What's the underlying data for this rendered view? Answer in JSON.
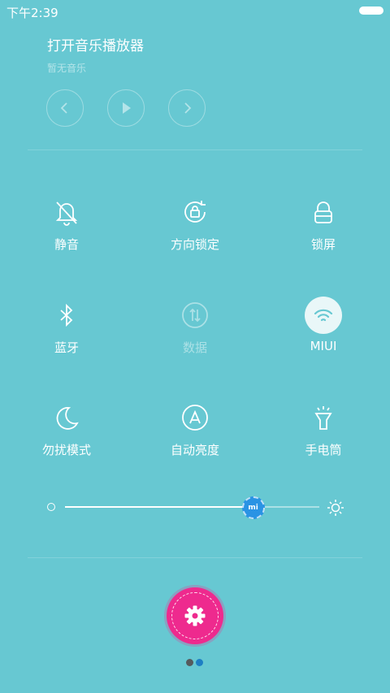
{
  "status": {
    "time": "下午2:39"
  },
  "music": {
    "title": "打开音乐播放器",
    "subtitle": "暂无音乐"
  },
  "toggles": [
    {
      "label": "静音"
    },
    {
      "label": "方向锁定"
    },
    {
      "label": "锁屏"
    },
    {
      "label": "蓝牙"
    },
    {
      "label": "数据"
    },
    {
      "label": "MIUI"
    },
    {
      "label": "勿扰模式"
    },
    {
      "label": "自动亮度"
    },
    {
      "label": "手电筒"
    }
  ],
  "brightness": {
    "level_fraction": 0.74,
    "knob_label": "mi"
  },
  "pager": {
    "count": 2,
    "active": 2
  },
  "colors": {
    "background": "#67c8d2",
    "accent": "#ee2a8e",
    "slider_knob": "#2a93e4",
    "wifi_active": "#e9f7f8"
  }
}
